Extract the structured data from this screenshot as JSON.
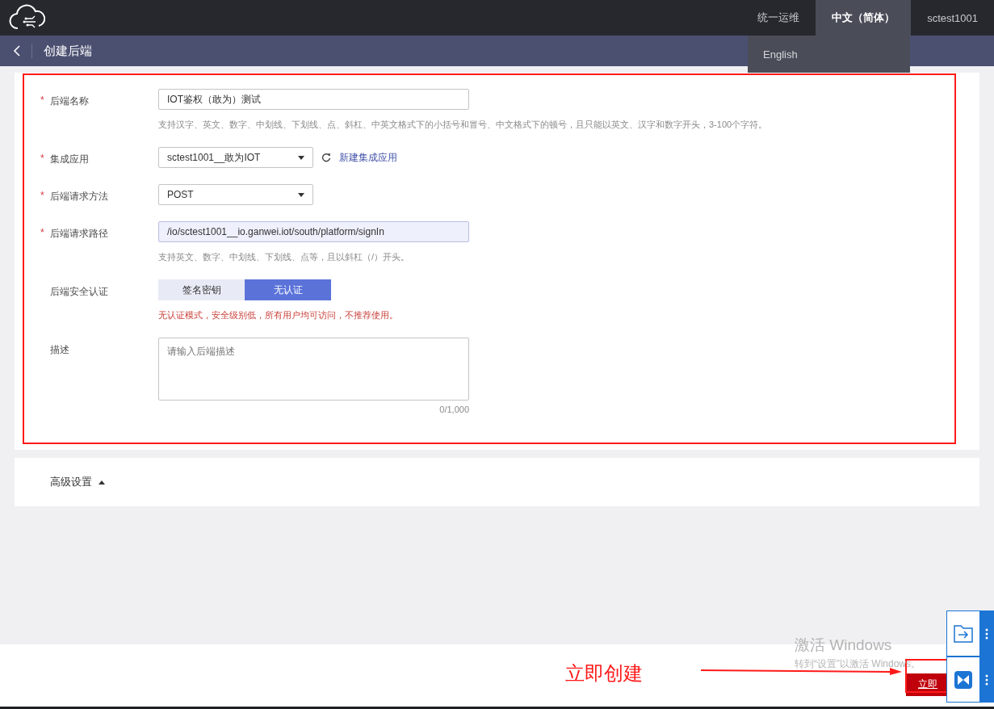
{
  "topbar": {
    "nav": [
      {
        "label": "统一运维",
        "selected": false
      },
      {
        "label": "中文（简体）",
        "selected": true
      },
      {
        "label": "sctest1001",
        "selected": false
      }
    ],
    "language_menu": [
      "English"
    ]
  },
  "header": {
    "title": "创建后端"
  },
  "form": {
    "fields": [
      {
        "kind": "input",
        "label": "后端名称",
        "required_mark": "*",
        "value": "IOT鉴权（敢为）测试",
        "focused": false,
        "hint": "支持汉字、英文、数字、中划线、下划线、点、斜杠、中英文格式下的小括号和冒号、中文格式下的顿号，且只能以英文、汉字和数字开头，3-100个字符。"
      },
      {
        "kind": "select",
        "label": "集成应用",
        "required_mark": "*",
        "value": "sctest1001__敢为IOT",
        "link": "新建集成应用"
      },
      {
        "kind": "select",
        "label": "后端请求方法",
        "required_mark": "*",
        "value": "POST"
      },
      {
        "kind": "input",
        "label": "后端请求路径",
        "required_mark": "*",
        "value": "/io/sctest1001__io.ganwei.iot/south/platform/signIn",
        "focused": true,
        "hint": "支持英文、数字、中划线、下划线、点等，且以斜杠（/）开头。"
      },
      {
        "kind": "segmented",
        "label": "后端安全认证",
        "options": [
          {
            "label": "签名密钥",
            "selected": false
          },
          {
            "label": "无认证",
            "selected": true
          }
        ],
        "warning": "无认证模式，安全级别低，所有用户均可访问，不推荐使用。"
      },
      {
        "kind": "textarea",
        "label": "描述",
        "placeholder": "请输入后端描述",
        "counter": "0/1,000"
      }
    ]
  },
  "advanced": {
    "label": "高级设置",
    "expanded": false
  },
  "footer": {
    "button": "立即"
  },
  "annotation": {
    "text": "立即创建"
  },
  "os_notice": {
    "title": "激活 Windows",
    "text": "转到“设置”以激活 Windows。"
  }
}
